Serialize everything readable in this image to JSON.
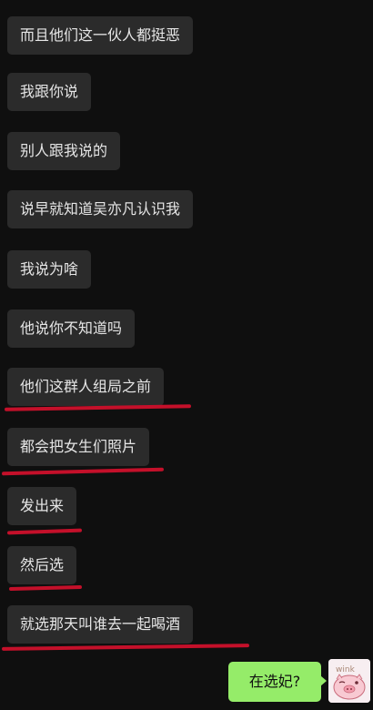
{
  "messages": [
    {
      "text": "而且他们这一伙人都挺恶"
    },
    {
      "text": "我跟你说"
    },
    {
      "text": "别人跟我说的"
    },
    {
      "text": "说早就知道吴亦凡认识我"
    },
    {
      "text": "我说为啥"
    },
    {
      "text": "他说你不知道吗"
    },
    {
      "text": "他们这群人组局之前"
    },
    {
      "text": "都会把女生们照片"
    },
    {
      "text": "发出来"
    },
    {
      "text": "然后选"
    },
    {
      "text": "就选那天叫谁去一起喝酒"
    }
  ],
  "my_message": {
    "text": "在选妃?"
  },
  "avatar": {
    "icon": "pig-sticker-icon",
    "sticker_text": "wink"
  },
  "colors": {
    "background": "#0f0f0f",
    "incoming_bubble": "#2b2b2b",
    "outgoing_bubble": "#95ec69",
    "underline": "#c4102a"
  }
}
